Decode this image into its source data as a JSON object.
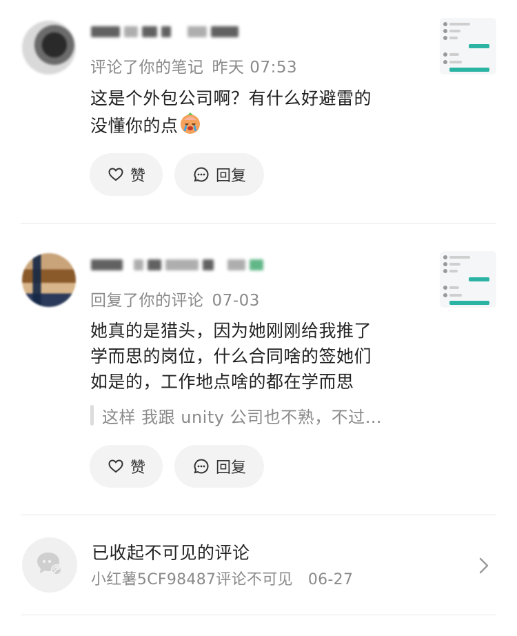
{
  "notifications": [
    {
      "action": "评论了你的笔记",
      "time": "昨天 07:53",
      "content_line1": "这是个外包公司啊？有什么好避雷的",
      "content_line2": "没懂你的点",
      "emoji_icon": "crying-face-icon",
      "like_label": "赞",
      "reply_label": "回复"
    },
    {
      "action": "回复了你的评论",
      "time": "07-03",
      "content_line1": "她真的是猎头，因为她刚刚给我推了",
      "content_line2": "学而思的岗位，什么合同啥的签她们",
      "content_line3": "如是的，工作地点啥的都在学而思",
      "quote": "这样 我跟 unity 公司也不熟，不过…",
      "like_label": "赞",
      "reply_label": "回复"
    }
  ],
  "hidden_comments": {
    "title": "已收起不可见的评论",
    "subtitle": "小红薯5CF98487评论不可见",
    "time": "06-27"
  },
  "colors": {
    "secondary_text": "#8a8a8a",
    "button_bg": "#f3f3f3",
    "thumb_accent": "#2bb3a3"
  }
}
